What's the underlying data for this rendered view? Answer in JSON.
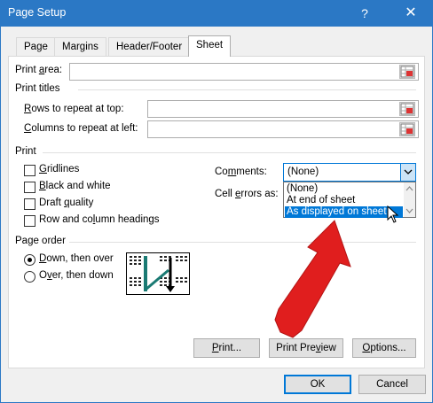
{
  "window": {
    "title": "Page Setup",
    "help_glyph": "?",
    "close_glyph": "✕"
  },
  "tabs": [
    {
      "label": "Page"
    },
    {
      "label": "Margins"
    },
    {
      "label": "Header/Footer"
    },
    {
      "label": "Sheet",
      "active": true
    }
  ],
  "print_area": {
    "label_pre": "Print ",
    "label_u": "a",
    "label_post": "rea:",
    "value": ""
  },
  "print_titles": {
    "heading": "Print titles",
    "rows_label_pre": "",
    "rows_label_u": "R",
    "rows_label_post": "ows to repeat at top:",
    "rows_value": "",
    "cols_label_pre": "",
    "cols_label_u": "C",
    "cols_label_post": "olumns to repeat at left:",
    "cols_value": ""
  },
  "print": {
    "heading": "Print",
    "checkboxes": [
      {
        "pre": "",
        "u": "G",
        "post": "ridlines",
        "checked": false
      },
      {
        "pre": "",
        "u": "B",
        "post": "lack and white",
        "checked": false
      },
      {
        "pre": "Draft ",
        "u": "q",
        "post": "uality",
        "checked": false
      },
      {
        "pre": "Row and co",
        "u": "l",
        "post": "umn headings",
        "checked": false
      }
    ],
    "comments_label_pre": "Co",
    "comments_label_u": "m",
    "comments_label_post": "ments:",
    "comments_value": "(None)",
    "comments_options": [
      "(None)",
      "At end of sheet",
      "As displayed on sheet"
    ],
    "highlighted_option": "As displayed on sheet",
    "cell_errors_label_pre": "Cell ",
    "cell_errors_label_u": "e",
    "cell_errors_label_post": "rrors as:"
  },
  "page_order": {
    "heading": "Page order",
    "options": [
      {
        "pre": "",
        "u": "D",
        "post": "own, then over",
        "selected": true
      },
      {
        "pre": "O",
        "u": "v",
        "post": "er, then down",
        "selected": false
      }
    ]
  },
  "buttons": {
    "print_pre": "",
    "print_u": "P",
    "print_post": "rint...",
    "preview_pre": "Print Pre",
    "preview_u": "v",
    "preview_post": "iew",
    "options_pre": "",
    "options_u": "O",
    "options_post": "ptions...",
    "ok": "OK",
    "cancel": "Cancel"
  },
  "colors": {
    "accent": "#0078d7",
    "titlebar": "#2b78c5",
    "arrow": "#e01e1e"
  }
}
